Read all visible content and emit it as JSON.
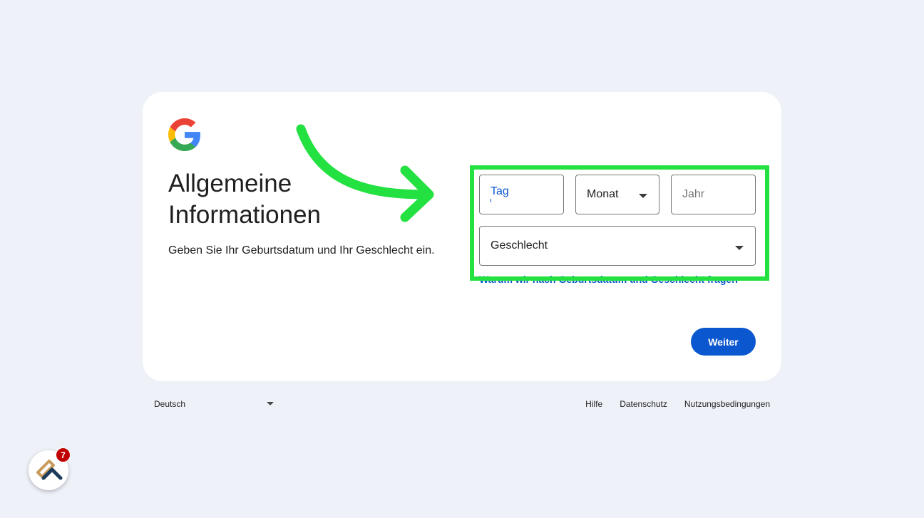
{
  "card": {
    "title_line1": "Allgemeine",
    "title_line2": "Informationen",
    "subtitle": "Geben Sie Ihr Geburtsdatum und Ihr Geschlecht ein."
  },
  "form": {
    "day_label": "Tag",
    "month_label": "Monat",
    "year_label": "Jahr",
    "gender_label": "Geschlecht",
    "why_link": "Warum wir nach Geburtsdatum und Geschlecht fragen",
    "next_button": "Weiter"
  },
  "footer": {
    "language": "Deutsch",
    "links": [
      "Hilfe",
      "Datenschutz",
      "Nutzungsbedingungen"
    ]
  },
  "extension": {
    "badge_count": "7"
  },
  "colors": {
    "background": "#eef1f8",
    "accent": "#0b57d0",
    "highlight": "#22e140"
  }
}
